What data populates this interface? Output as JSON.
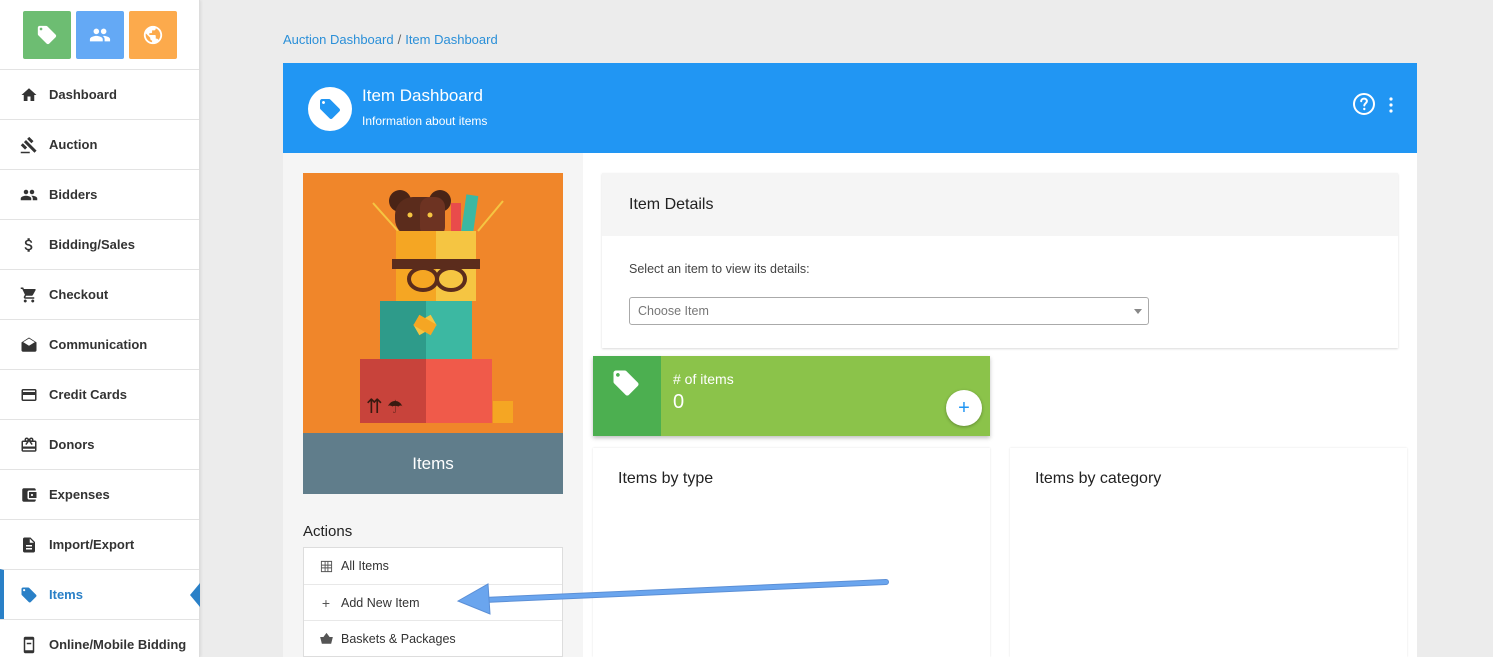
{
  "sidebar": {
    "top_icons": [
      {
        "name": "tag-icon",
        "color": "#6dbd72"
      },
      {
        "name": "people-icon",
        "color": "#64a9f5"
      },
      {
        "name": "globe-icon",
        "color": "#fcaa4c"
      }
    ],
    "items": [
      {
        "label": "Dashboard",
        "icon": "home-icon"
      },
      {
        "label": "Auction",
        "icon": "gavel-icon"
      },
      {
        "label": "Bidders",
        "icon": "people-icon"
      },
      {
        "label": "Bidding/Sales",
        "icon": "dollar-icon"
      },
      {
        "label": "Checkout",
        "icon": "cart-icon"
      },
      {
        "label": "Communication",
        "icon": "mail-icon"
      },
      {
        "label": "Credit Cards",
        "icon": "credit-card-icon"
      },
      {
        "label": "Donors",
        "icon": "gift-icon"
      },
      {
        "label": "Expenses",
        "icon": "wallet-icon"
      },
      {
        "label": "Import/Export",
        "icon": "document-icon"
      },
      {
        "label": "Items",
        "icon": "tag-icon",
        "active": true
      },
      {
        "label": "Online/Mobile Bidding",
        "icon": "mobile-icon"
      }
    ]
  },
  "breadcrumb": {
    "items": [
      "Auction Dashboard",
      "Item Dashboard"
    ],
    "separator": "/"
  },
  "header": {
    "title": "Item Dashboard",
    "subtitle": "Information about items",
    "color": "#2196f3"
  },
  "left_panel": {
    "caption": "Items",
    "actions_title": "Actions",
    "actions": [
      {
        "label": "All Items",
        "icon": "grid-icon"
      },
      {
        "label": "Add New Item",
        "icon": "plus-icon"
      },
      {
        "label": "Baskets & Packages",
        "icon": "basket-icon"
      }
    ]
  },
  "details": {
    "title": "Item Details",
    "label": "Select an item to view its details:",
    "select_placeholder": "Choose Item"
  },
  "stat": {
    "label": "# of items",
    "value": "0",
    "add_symbol": "+"
  },
  "panels": {
    "by_type": "Items by type",
    "by_category": "Items by category"
  },
  "annotation": {
    "arrow_color": "#6aa5ee"
  }
}
